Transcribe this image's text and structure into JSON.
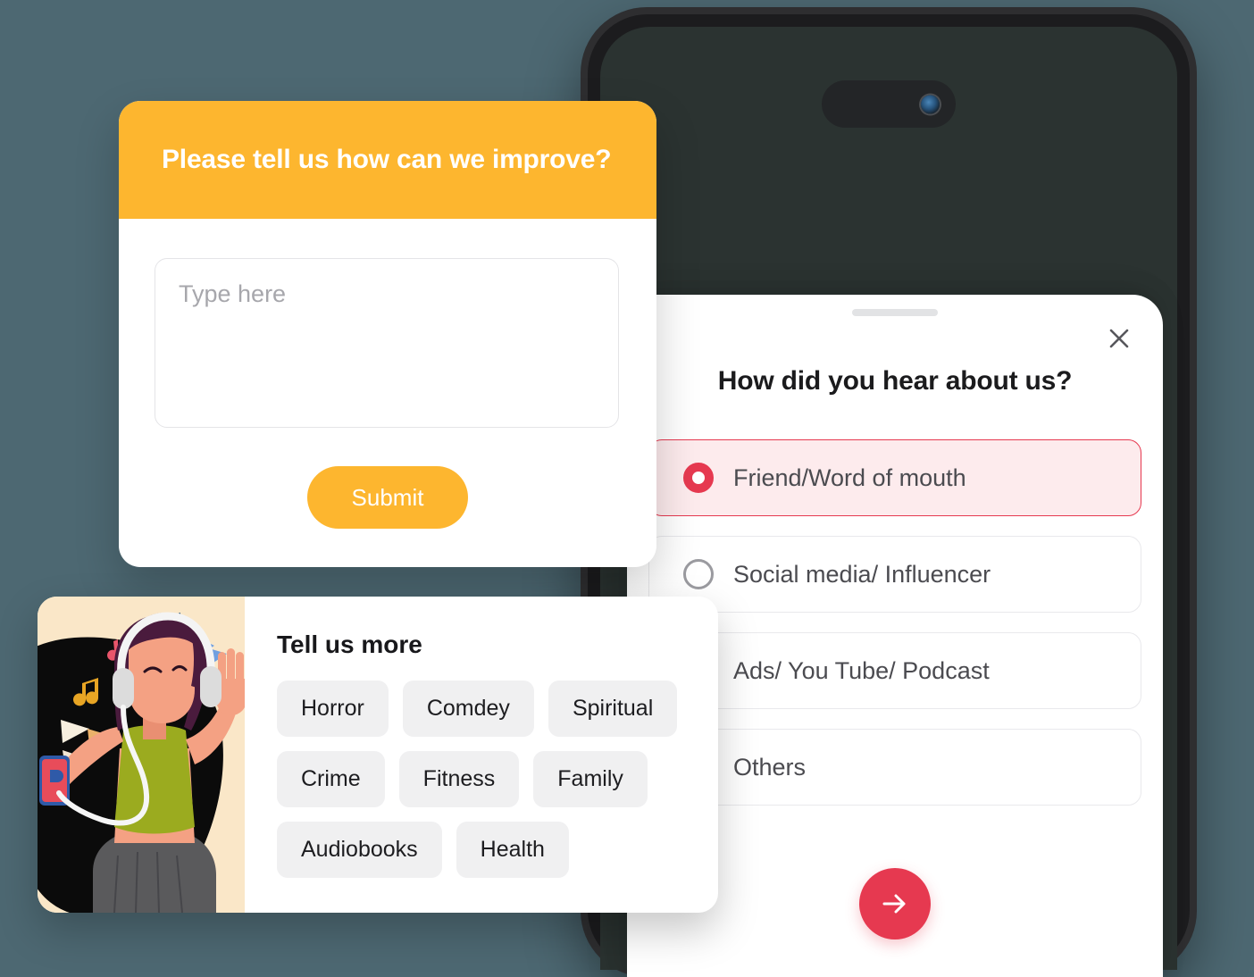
{
  "theme": {
    "background": "#4D6872",
    "accent_orange": "#FDB62F",
    "accent_crimson": "#E63950",
    "selected_tint": "#FDEBED",
    "phone_body": "#2E2E30",
    "phone_screen": "#2B3331"
  },
  "phone": {
    "dynamic_island": "dynamic-island",
    "camera": "front-camera-lens",
    "power_button": "power-button",
    "volume_buttons": [
      "mute-switch",
      "volume-up-button",
      "volume-down-button"
    ]
  },
  "feedback_card": {
    "title": "Please tell us how can we improve?",
    "textarea_placeholder": "Type here",
    "textarea_value": "",
    "submit_label": "Submit"
  },
  "tell_us_more": {
    "title": "Tell us more",
    "illustration": "woman-listening-music-illustration",
    "tags": [
      "Horror",
      "Comdey",
      "Spiritual",
      "Crime",
      "Fitness",
      "Family",
      "Audiobooks",
      "Health"
    ]
  },
  "bottom_sheet": {
    "handle": "drag-handle",
    "close_icon": "close-icon",
    "title": "How did you hear about us?",
    "options": [
      {
        "label": "Friend/Word of mouth",
        "selected": true
      },
      {
        "label": "Social media/ Influencer",
        "selected": false
      },
      {
        "label": "Ads/ You Tube/ Podcast",
        "selected": false
      },
      {
        "label": "Others",
        "selected": false
      }
    ],
    "next_icon": "arrow-right-icon"
  }
}
